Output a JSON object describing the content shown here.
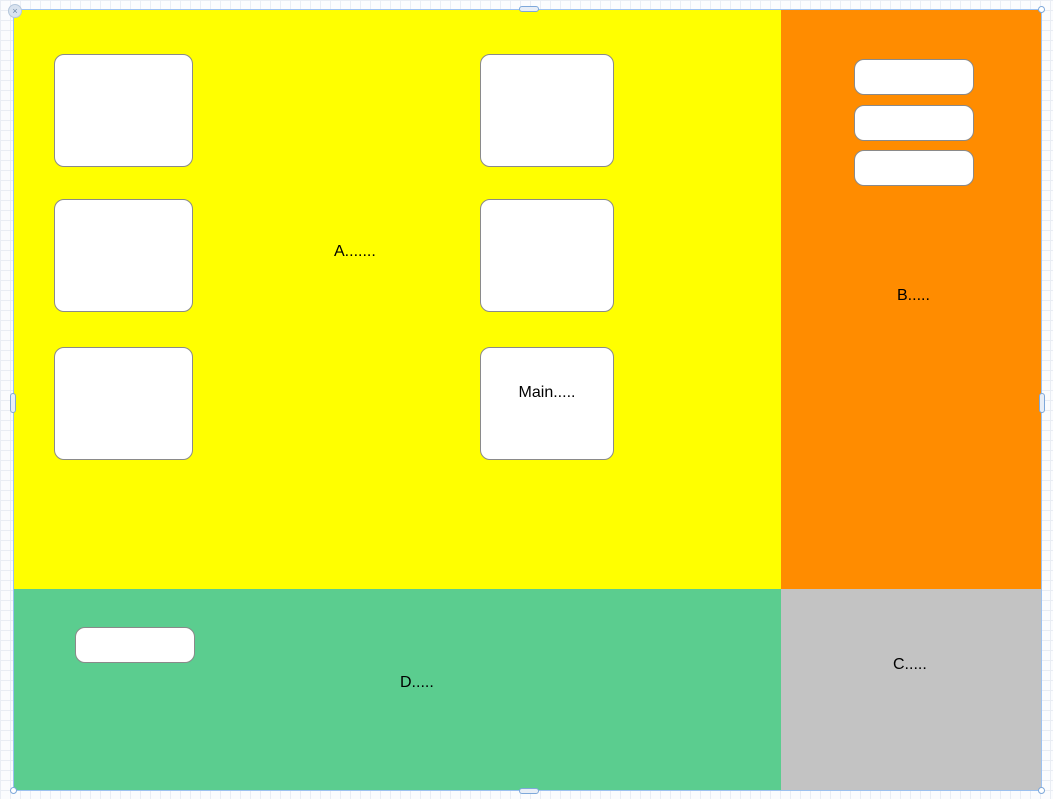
{
  "panels": {
    "a": {
      "label": "A......."
    },
    "b": {
      "label": "B....."
    },
    "c": {
      "label": "C....."
    },
    "d": {
      "label": "D....."
    }
  },
  "panelA": {
    "boxes": [
      {
        "label": ""
      },
      {
        "label": ""
      },
      {
        "label": ""
      },
      {
        "label": ""
      },
      {
        "label": ""
      },
      {
        "label": "Main....."
      }
    ]
  },
  "panelB": {
    "pills": [
      {
        "label": ""
      },
      {
        "label": ""
      },
      {
        "label": ""
      }
    ]
  },
  "panelD": {
    "pills": [
      {
        "label": ""
      }
    ]
  },
  "closeBadge": "×"
}
